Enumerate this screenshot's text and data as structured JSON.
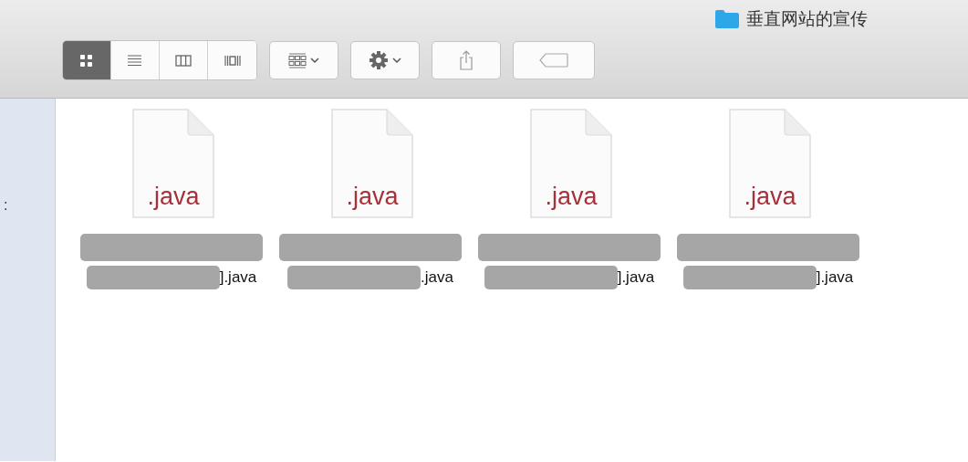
{
  "window": {
    "title": "垂直网站的宣传"
  },
  "view_buttons": [
    {
      "kind": "icons",
      "selected": true
    },
    {
      "kind": "list",
      "selected": false
    },
    {
      "kind": "columns",
      "selected": false
    },
    {
      "kind": "coverflow",
      "selected": false
    }
  ],
  "sidebar": {
    "label": ":"
  },
  "files": [
    {
      "icon_label": ".java",
      "name_end": "].java"
    },
    {
      "icon_label": ".java",
      "name_end": ".java"
    },
    {
      "icon_label": ".java",
      "name_end": "].java"
    },
    {
      "icon_label": ".java",
      "name_end": "].java"
    }
  ]
}
